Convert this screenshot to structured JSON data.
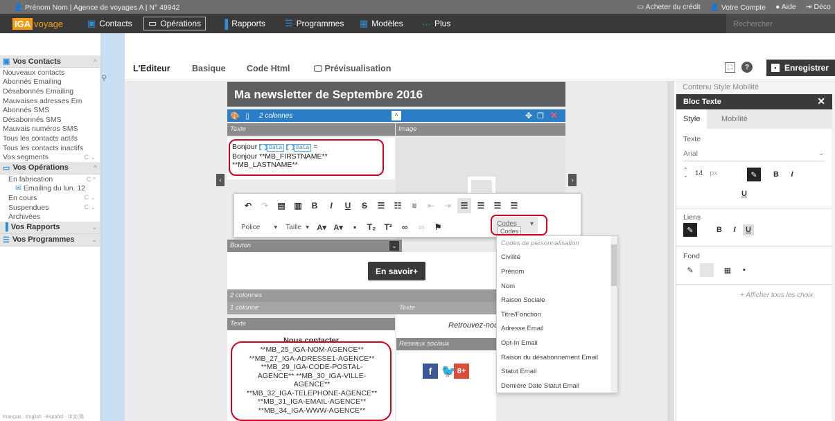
{
  "topbar": {
    "user": "Prénom Nom | Agence de voyages A | N° 49942",
    "buy_credit": "Acheter du crédit",
    "account": "Votre Compte",
    "help": "Aide",
    "logout": "Déco"
  },
  "nav": {
    "logo_badge": "IGA",
    "logo_text": "voyage",
    "items": [
      "Contacts",
      "Opérations",
      "Rapports",
      "Programmes",
      "Modèles",
      "Plus"
    ],
    "search_placeholder": "Rechercher"
  },
  "sidebar": {
    "contacts_title": "Vos Contacts",
    "contacts": [
      "Nouveaux contacts",
      "Abonnés Emailing",
      "Désabonnés Emailing",
      "Mauvaises adresses Em",
      "Abonnés SMS",
      "Désabonnés SMS",
      "Mauvais numéros SMS",
      "Tous les contacts actifs",
      "Tous les contacts inactifs",
      "Vos segments"
    ],
    "operations_title": "Vos Opérations",
    "operations": [
      "En fabrication",
      "Emailing du lun. 12",
      "En cours",
      "Suspendues",
      "Archivées"
    ],
    "rapports_title": "Vos Rapports",
    "programmes_title": "Vos Programmes",
    "languages": "Français · English · Español · 中文(简"
  },
  "editor": {
    "tabs": [
      "L'Editeur",
      "Basique",
      "Code Html",
      "Prévisualisation"
    ],
    "save": "Enregistrer"
  },
  "newsletter": {
    "title": "Ma newsletter de Septembre 2016",
    "block_label": "2 colonnes",
    "col_texte": "Texte",
    "col_image": "Image",
    "greeting_line1": "Bonjour",
    "chip": "Data",
    "equals": "=",
    "greeting_line2": "Bonjour **MB_FIRSTNAME**",
    "greeting_line3": "**MB_LASTNAME**",
    "bouton_label": "Bouton",
    "button_text": "En savoir+",
    "deux_colonnes": "2 colonnes",
    "une_colonne": "1 colonne",
    "texte_a": "Texte",
    "texte_b": "Texte",
    "retrouvez": "Retrouvez-nous",
    "reseaux": "Reseaux sociaux",
    "nous_contacter": "Nous contacter",
    "codes": [
      "**MB_25_IGA-NOM-AGENCE**",
      "**MB_27_IGA-ADRESSE1-AGENCE**",
      "**MB_29_IGA-CODE-POSTAL-",
      "AGENCE** **MB_30_IGA-VILLE-",
      "AGENCE**",
      "**MB_32_IGA-TELEPHONE-AGENCE**",
      "**MB_31_IGA-EMAIL-AGENCE**",
      "**MB_34_IGA-WWW-AGENCE**"
    ]
  },
  "toolbar": {
    "police": "Police",
    "taille": "Taille",
    "codes": "Codes",
    "codes_tooltip": "Codes"
  },
  "codes_dropdown": {
    "header": "Codes de personnalisation",
    "options": [
      "Civilité",
      "Prénom",
      "Nom",
      "Raison Sociale",
      "Titre/Fonction",
      "Adresse Email",
      "Opt-In Email",
      "Raison du désabonnement Email",
      "Statut Email",
      "Dernière Date Statut Email"
    ]
  },
  "panel": {
    "back_tabs": "Contenu   Style   Mobilité",
    "title": "Bloc Texte",
    "tab_style": "Style",
    "tab_mobilite": "Mobilité",
    "texte_label": "Texte",
    "font": "Arial",
    "size_value": "14",
    "size_unit": "px",
    "bold": "B",
    "italic": "I",
    "underline": "U",
    "liens_label": "Liens",
    "fond_label": "Fond",
    "show_all": "+ Afficher tous les choix"
  },
  "colors": {
    "accent": "#2a7ec8",
    "logo": "#f39c12",
    "highlight": "#d0021b"
  }
}
